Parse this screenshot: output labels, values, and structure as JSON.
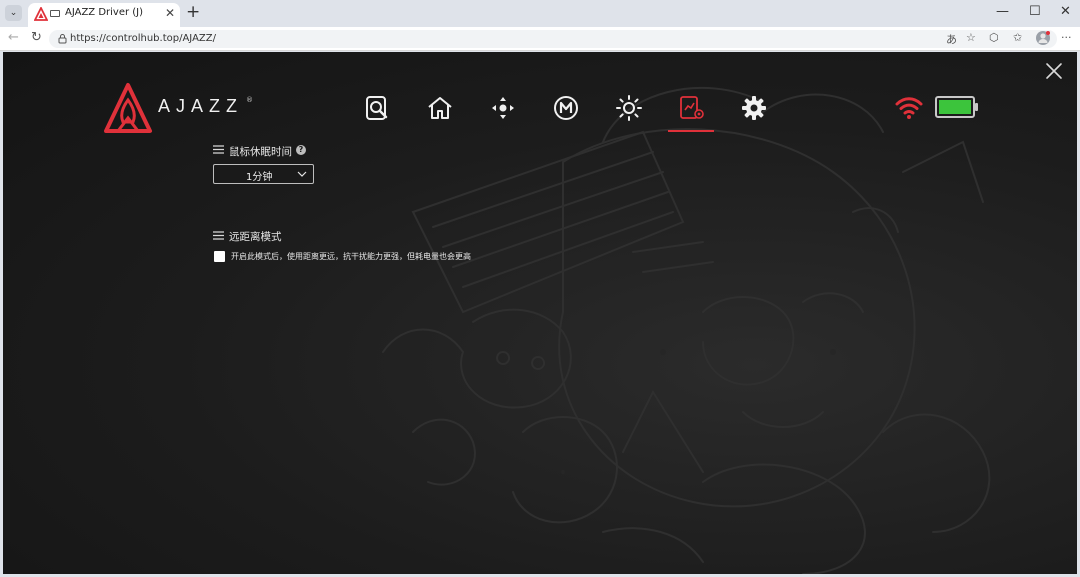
{
  "browser": {
    "tab_title": "AJAZZ Driver (J)",
    "tab_close": "✕",
    "new_tab": "+",
    "url": "https://controlhub.top/AJAZZ/",
    "window_controls": {
      "minimize": "—",
      "maximize": "☐",
      "close": "✕"
    },
    "nav": {
      "back": "←",
      "reload": "↻"
    },
    "omnibox_icons": [
      "translate-icon",
      "star-icon",
      "extensions-icon",
      "favorites-icon",
      "profile-icon",
      "more-icon"
    ]
  },
  "app": {
    "brand": {
      "logo_text": "AJAZZ",
      "registered": "®",
      "accent_color": "#e0313a"
    },
    "close_label": "close",
    "nav_icons": [
      "search-doc-icon",
      "home-icon",
      "direction-pad-icon",
      "macro-m-icon",
      "lighting-icon",
      "power-settings-icon",
      "gear-icon"
    ],
    "active_nav": "power-settings-icon",
    "status": {
      "wifi_color": "#e0313a",
      "battery_color": "#3cc43c",
      "battery_level": 1.0
    },
    "sleep": {
      "title": "鼠标休眠时间",
      "help": "?",
      "selected": "1分钟"
    },
    "long_range": {
      "title": "远距离模式",
      "checked": true,
      "description": "开启此模式后，使用距离更远，抗干扰能力更强，但耗电量也会更高"
    }
  }
}
